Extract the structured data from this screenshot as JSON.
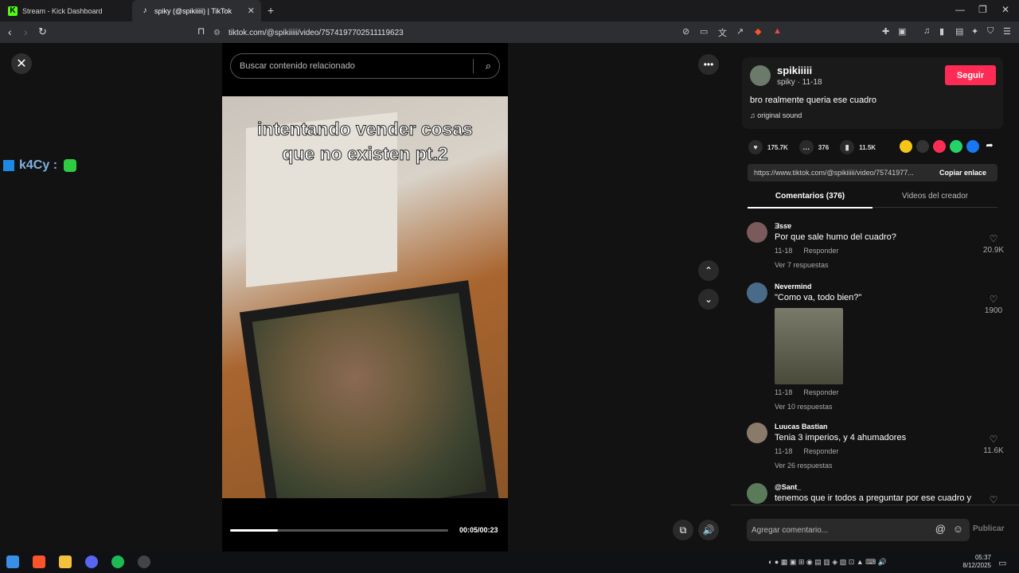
{
  "browser": {
    "tabs": [
      {
        "label": "Stream - Kick Dashboard",
        "active": false
      },
      {
        "label": "spiky (@spikiiiii) | TikTok",
        "active": true
      }
    ],
    "url": "tiktok.com/@spikiiiii/video/7574197702511119623",
    "accent": "#fe2c55"
  },
  "overlay": {
    "text": "k4Cy :"
  },
  "video": {
    "search_placeholder": "Buscar contenido relacionado",
    "caption_line1": "intentando vender cosas",
    "caption_line2": "que no existen pt.2",
    "time": "00:05/00:23",
    "progress": 0.22
  },
  "creator": {
    "username": "spikiiiii",
    "sub": "spiky · 11-18",
    "follow_label": "Seguir",
    "description": "bro realmente queria ese cuadro",
    "sound": "original sound"
  },
  "stats": {
    "likes": "175.7K",
    "comments": "376",
    "saves": "11.5K"
  },
  "link": {
    "url": "https://www.tiktok.com/@spikiiiii/video/75741977...",
    "copy_label": "Copiar enlace"
  },
  "panel_tabs": {
    "comments": "Comentarios (376)",
    "creator_videos": "Videos del creador"
  },
  "comments": [
    {
      "name": "Ǝssɐ",
      "text": "Por que sale humo del cuadro?",
      "date": "11-18",
      "reply": "Responder",
      "replies": "Ver 7 respuestas",
      "likes": "20.9K"
    },
    {
      "name": "Nevermind",
      "text": "\"Como va, todo bien?\"",
      "date": "11-18",
      "reply": "Responder",
      "replies": "Ver 10 respuestas",
      "likes": "1900"
    },
    {
      "name": "Luucas Bastian",
      "text": "Tenia 3 imperios, y 4 ahumadores",
      "date": "11-18",
      "reply": "Responder",
      "replies": "Ver 26 respuestas",
      "likes": "11.6K"
    },
    {
      "name": "@Sant_",
      "text": "tenemos que ir todos a preguntar por ese cuadro y"
    }
  ],
  "comment_input": {
    "placeholder": "Agregar comentario...",
    "publish": "Publicar"
  },
  "taskbar": {
    "time": "05:37",
    "date": "8/12/2025"
  }
}
